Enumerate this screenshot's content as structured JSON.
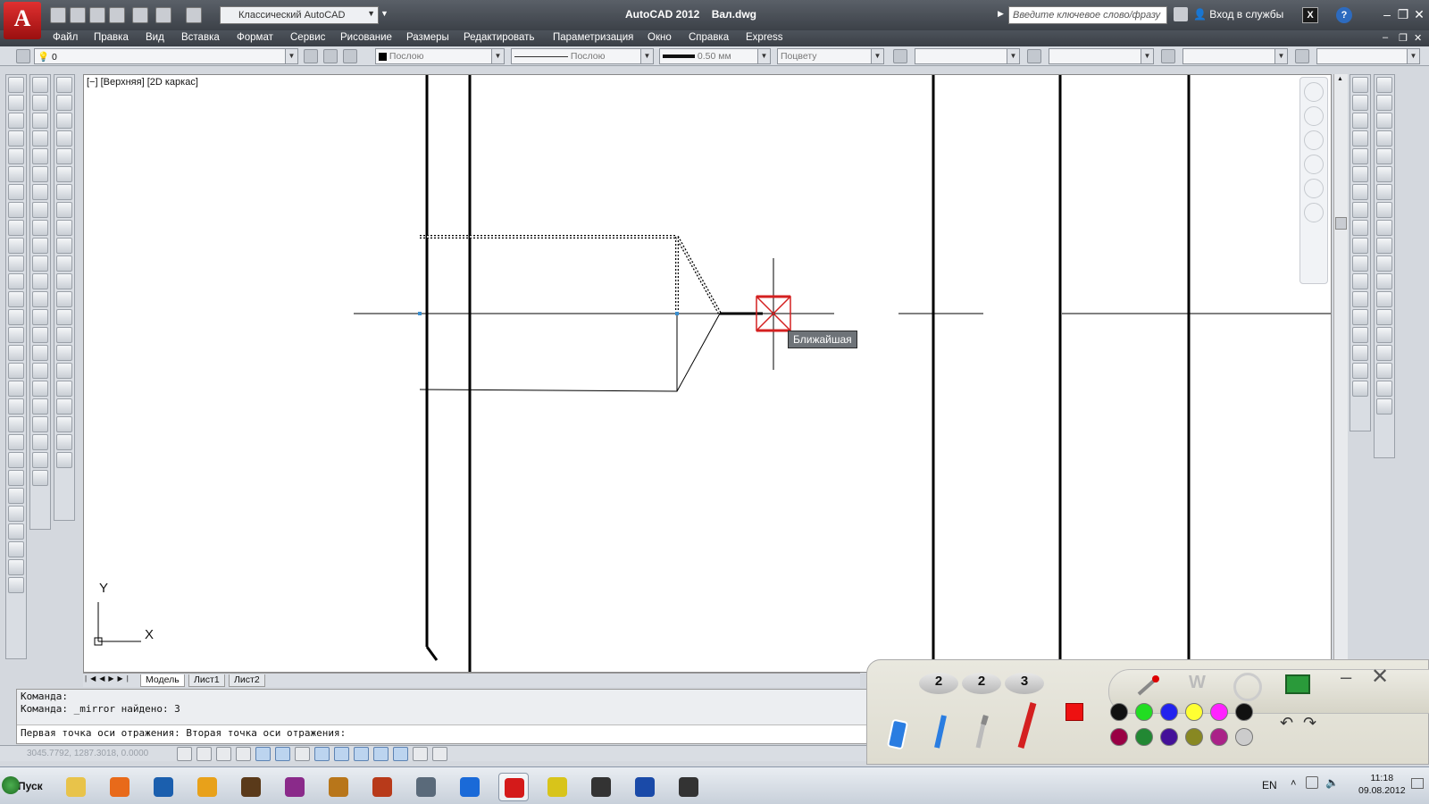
{
  "title_bar": {
    "app_logo_letter": "A",
    "workspace": "Классический AutoCAD",
    "app_name": "AutoCAD 2012",
    "file_name": "Вал.dwg",
    "search_placeholder": "Введите ключевое слово/фразу",
    "login_label": "Вход в службы",
    "help_icon": "?"
  },
  "menu": [
    "Файл",
    "Правка",
    "Вид",
    "Вставка",
    "Формат",
    "Сервис",
    "Рисование",
    "Размеры",
    "Редактировать",
    "Параметризация",
    "Окно",
    "Справка",
    "Express"
  ],
  "properties_bar": {
    "layer_value": "0",
    "color_value": "Послою",
    "linetype_value": "Послою",
    "lineweight_value": "0.50 мм",
    "plotstyle_value": "Поцвету"
  },
  "viewport": {
    "label": "[−] [Верхняя] [2D каркас]",
    "snap_tooltip": "Ближайшая",
    "ucs_x": "X",
    "ucs_y": "Y"
  },
  "layout_tabs": [
    "Модель",
    "Лист1",
    "Лист2"
  ],
  "command_line": {
    "line1": "Команда:",
    "line2": "Команда: _mirror найдено: 3",
    "line3": "Первая точка оси отражения: Вторая точка оси отражения:"
  },
  "status_bar": {
    "coords": "3045.7792, 1287.3018, 0.0000"
  },
  "pen_palette": {
    "pen_sizes": [
      "2",
      "2",
      "3"
    ],
    "active_color": "#e02020",
    "colors_row1": [
      "#111111",
      "#22dd22",
      "#2222ee",
      "#ffff33",
      "#ff22ff",
      "#111111"
    ],
    "colors_row2": [
      "#990044",
      "#228833",
      "#441199",
      "#888822",
      "#aa2288",
      "#cccccc"
    ]
  },
  "taskbar": {
    "start_label": "Пуск",
    "language": "EN",
    "time": "11:18",
    "date": "09.08.2012",
    "apps": [
      "folder-icon",
      "media-player-icon",
      "hp-icon",
      "tools-icon",
      "game-helmet-icon",
      "game-emblem-icon",
      "game-dragon-icon",
      "game-warrior-icon",
      "camera-icon",
      "chart-app-icon",
      "autocad-icon",
      "v-app-icon",
      "shredder-icon",
      "word-icon",
      "shredder2-icon"
    ]
  }
}
